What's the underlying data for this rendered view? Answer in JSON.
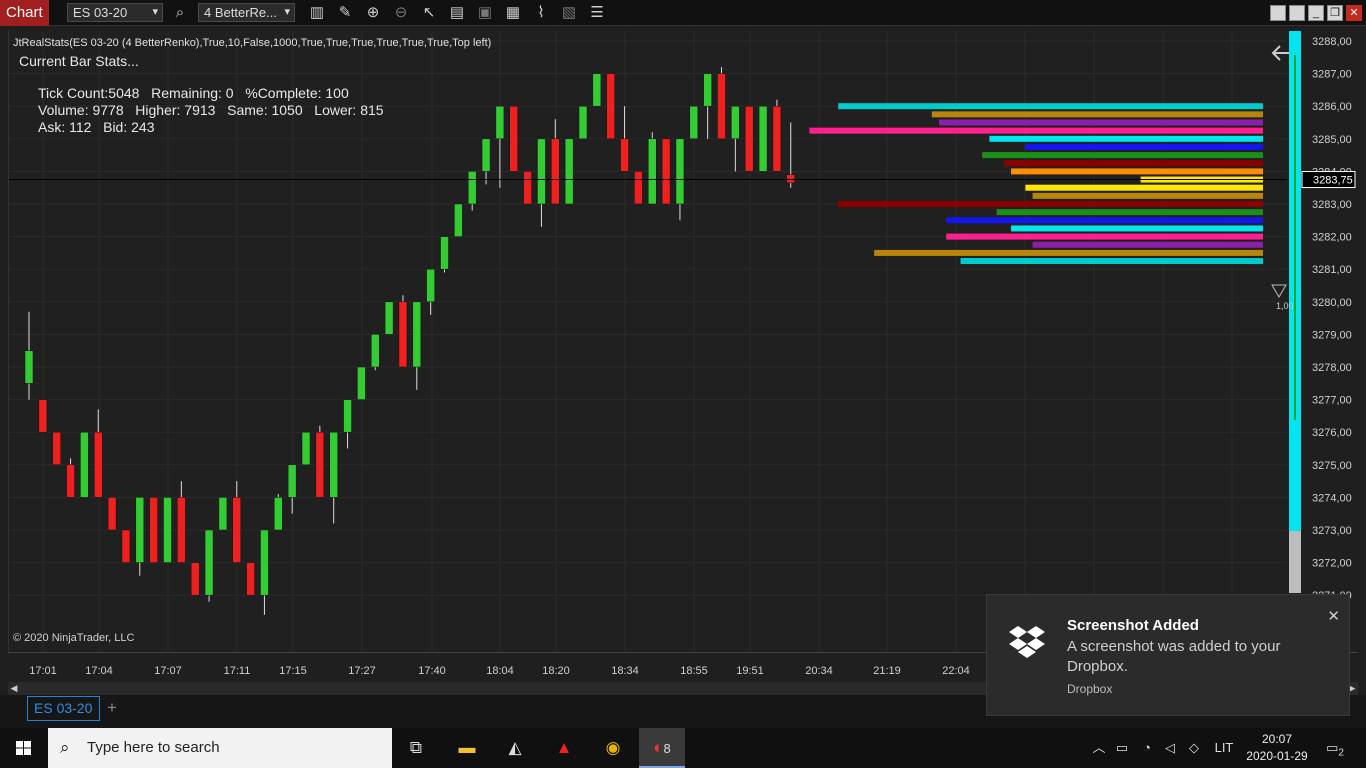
{
  "toolbar": {
    "chart_tab": "Chart",
    "instrument": "ES 03-20",
    "bar_type": "4 BetterRe...",
    "icons": [
      "search-icon",
      "bar-style-icon",
      "drawing-tool-icon",
      "zoom-in-icon",
      "zoom-out-icon",
      "pointer-icon",
      "data-box-icon",
      "chart-properties-icon",
      "strategy-icon",
      "indicator-icon",
      "templates-icon",
      "menu-icon"
    ],
    "window_controls": [
      "tile-icon",
      "minimize-icon",
      "restore-icon",
      "close-icon"
    ]
  },
  "chart": {
    "indicator_label": "JtRealStats(ES 03-20 (4 BetterRenko),True,10,False,1000,True,True,True,True,True,True,Top left)",
    "stats_title": "Current Bar Stats...",
    "stats_lines": [
      "Tick Count:5048   Remaining: 0   %Complete: 100",
      "Volume: 9778   Higher: 7913   Same: 1050   Lower: 815",
      "Ask: 112   Bid: 243"
    ],
    "copyright": "© 2020 NinjaTrader, LLC",
    "current_price_label": "3283,75",
    "price_ticks": [
      "3288,00",
      "3287,00",
      "3286,00",
      "3285,00",
      "3284,00",
      "3283,00",
      "3282,00",
      "3281,00",
      "3280,00",
      "3279,00",
      "3278,00",
      "3277,00",
      "3276,00",
      "3275,00",
      "3274,00",
      "3273,00",
      "3272,00",
      "3271,00"
    ],
    "time_ticks": [
      "17:01",
      "17:04",
      "17:07",
      "17:11",
      "17:15",
      "17:27",
      "17:40",
      "18:04",
      "18:20",
      "18:34",
      "18:55",
      "19:51",
      "20:34",
      "21:19",
      "22:04"
    ],
    "side_marker": "1,00",
    "colors": {
      "up": "#33cc33",
      "down": "#ee2020",
      "wick": "#dddddd",
      "volume_bar": "#00e5ee"
    }
  },
  "chart_data": {
    "type": "candlestick",
    "y_unit": "price",
    "ylim": [
      3270.75,
      3288.25
    ],
    "candles": [
      {
        "o": 3277.5,
        "c": 3278.5,
        "l": 3277.0,
        "h": 3279.7
      },
      {
        "o": 3277.0,
        "c": 3276.0,
        "l": 3276.0,
        "h": 3277.0
      },
      {
        "o": 3276.0,
        "c": 3275.0,
        "l": 3275.0,
        "h": 3276.0
      },
      {
        "o": 3275.0,
        "c": 3274.0,
        "l": 3274.0,
        "h": 3275.2
      },
      {
        "o": 3274.0,
        "c": 3276.0,
        "l": 3274.0,
        "h": 3276.0
      },
      {
        "o": 3276.0,
        "c": 3274.0,
        "l": 3274.0,
        "h": 3276.7
      },
      {
        "o": 3274.0,
        "c": 3273.0,
        "l": 3273.0,
        "h": 3274.0
      },
      {
        "o": 3273.0,
        "c": 3272.0,
        "l": 3272.0,
        "h": 3273.0
      },
      {
        "o": 3272.0,
        "c": 3274.0,
        "l": 3271.6,
        "h": 3274.0
      },
      {
        "o": 3274.0,
        "c": 3272.0,
        "l": 3272.0,
        "h": 3274.0
      },
      {
        "o": 3272.0,
        "c": 3274.0,
        "l": 3272.0,
        "h": 3274.0
      },
      {
        "o": 3274.0,
        "c": 3272.0,
        "l": 3272.0,
        "h": 3274.5
      },
      {
        "o": 3272.0,
        "c": 3271.0,
        "l": 3271.0,
        "h": 3272.0
      },
      {
        "o": 3271.0,
        "c": 3273.0,
        "l": 3270.8,
        "h": 3273.0
      },
      {
        "o": 3273.0,
        "c": 3274.0,
        "l": 3273.0,
        "h": 3274.0
      },
      {
        "o": 3274.0,
        "c": 3272.0,
        "l": 3272.0,
        "h": 3274.5
      },
      {
        "o": 3272.0,
        "c": 3271.0,
        "l": 3271.0,
        "h": 3272.0
      },
      {
        "o": 3271.0,
        "c": 3273.0,
        "l": 3270.4,
        "h": 3273.0
      },
      {
        "o": 3273.0,
        "c": 3274.0,
        "l": 3273.0,
        "h": 3274.1
      },
      {
        "o": 3274.0,
        "c": 3275.0,
        "l": 3273.5,
        "h": 3275.0
      },
      {
        "o": 3275.0,
        "c": 3276.0,
        "l": 3275.0,
        "h": 3276.0
      },
      {
        "o": 3276.0,
        "c": 3274.0,
        "l": 3274.0,
        "h": 3276.2
      },
      {
        "o": 3274.0,
        "c": 3276.0,
        "l": 3273.2,
        "h": 3276.0
      },
      {
        "o": 3276.0,
        "c": 3277.0,
        "l": 3275.5,
        "h": 3277.0
      },
      {
        "o": 3277.0,
        "c": 3278.0,
        "l": 3277.0,
        "h": 3278.0
      },
      {
        "o": 3278.0,
        "c": 3279.0,
        "l": 3277.9,
        "h": 3279.0
      },
      {
        "o": 3279.0,
        "c": 3280.0,
        "l": 3279.0,
        "h": 3280.0
      },
      {
        "o": 3280.0,
        "c": 3278.0,
        "l": 3278.0,
        "h": 3280.2
      },
      {
        "o": 3278.0,
        "c": 3280.0,
        "l": 3277.3,
        "h": 3280.0
      },
      {
        "o": 3280.0,
        "c": 3281.0,
        "l": 3279.6,
        "h": 3281.0
      },
      {
        "o": 3281.0,
        "c": 3282.0,
        "l": 3280.9,
        "h": 3282.0
      },
      {
        "o": 3282.0,
        "c": 3283.0,
        "l": 3282.0,
        "h": 3283.0
      },
      {
        "o": 3283.0,
        "c": 3284.0,
        "l": 3282.8,
        "h": 3284.0
      },
      {
        "o": 3284.0,
        "c": 3285.0,
        "l": 3283.6,
        "h": 3285.0
      },
      {
        "o": 3285.0,
        "c": 3286.0,
        "l": 3283.5,
        "h": 3286.0
      },
      {
        "o": 3286.0,
        "c": 3284.0,
        "l": 3284.0,
        "h": 3286.0
      },
      {
        "o": 3284.0,
        "c": 3283.0,
        "l": 3283.0,
        "h": 3284.0
      },
      {
        "o": 3283.0,
        "c": 3285.0,
        "l": 3282.3,
        "h": 3285.0
      },
      {
        "o": 3285.0,
        "c": 3283.0,
        "l": 3283.0,
        "h": 3285.6
      },
      {
        "o": 3283.0,
        "c": 3285.0,
        "l": 3283.0,
        "h": 3285.0
      },
      {
        "o": 3285.0,
        "c": 3286.0,
        "l": 3285.0,
        "h": 3286.0
      },
      {
        "o": 3286.0,
        "c": 3287.0,
        "l": 3286.0,
        "h": 3287.0
      },
      {
        "o": 3287.0,
        "c": 3285.0,
        "l": 3285.0,
        "h": 3287.0
      },
      {
        "o": 3285.0,
        "c": 3284.0,
        "l": 3284.0,
        "h": 3286.0
      },
      {
        "o": 3284.0,
        "c": 3283.0,
        "l": 3283.0,
        "h": 3284.0
      },
      {
        "o": 3283.0,
        "c": 3285.0,
        "l": 3283.0,
        "h": 3285.2
      },
      {
        "o": 3285.0,
        "c": 3283.0,
        "l": 3283.0,
        "h": 3285.0
      },
      {
        "o": 3283.0,
        "c": 3285.0,
        "l": 3282.5,
        "h": 3285.0
      },
      {
        "o": 3285.0,
        "c": 3286.0,
        "l": 3285.0,
        "h": 3286.0
      },
      {
        "o": 3286.0,
        "c": 3287.0,
        "l": 3285.0,
        "h": 3287.0
      },
      {
        "o": 3287.0,
        "c": 3285.0,
        "l": 3285.0,
        "h": 3287.2
      },
      {
        "o": 3285.0,
        "c": 3286.0,
        "l": 3284.0,
        "h": 3286.0
      },
      {
        "o": 3286.0,
        "c": 3284.0,
        "l": 3284.0,
        "h": 3286.0
      },
      {
        "o": 3284.0,
        "c": 3286.0,
        "l": 3284.0,
        "h": 3286.0
      },
      {
        "o": 3286.0,
        "c": 3284.0,
        "l": 3284.0,
        "h": 3286.2
      },
      {
        "o": 3283.9,
        "c": 3283.65,
        "l": 3283.5,
        "h": 3285.5
      }
    ],
    "volume_profile": [
      {
        "price": 3286.0,
        "strength": 0.59,
        "color": "#00cccc"
      },
      {
        "price": 3285.75,
        "strength": 0.46,
        "color": "#b8860b"
      },
      {
        "price": 3285.5,
        "strength": 0.45,
        "color": "#8b1fa8"
      },
      {
        "price": 3285.25,
        "strength": 0.63,
        "color": "#ff1f8f"
      },
      {
        "price": 3285.0,
        "strength": 0.38,
        "color": "#00e5ee"
      },
      {
        "price": 3284.75,
        "strength": 0.33,
        "color": "#1515ee"
      },
      {
        "price": 3284.5,
        "strength": 0.39,
        "color": "#1a8f1a"
      },
      {
        "price": 3284.25,
        "strength": 0.36,
        "color": "#8b0000"
      },
      {
        "price": 3284.0,
        "strength": 0.35,
        "color": "#ff8c00"
      },
      {
        "price": 3283.75,
        "strength": 0.17,
        "color": "#ffe600"
      },
      {
        "price": 3283.5,
        "strength": 0.33,
        "color": "#ffe600"
      },
      {
        "price": 3283.25,
        "strength": 0.32,
        "color": "#b8860b"
      },
      {
        "price": 3283.0,
        "strength": 0.59,
        "color": "#8b0000"
      },
      {
        "price": 3282.75,
        "strength": 0.37,
        "color": "#1a8f1a"
      },
      {
        "price": 3282.5,
        "strength": 0.44,
        "color": "#1515ee"
      },
      {
        "price": 3282.25,
        "strength": 0.35,
        "color": "#00e5ee"
      },
      {
        "price": 3282.0,
        "strength": 0.44,
        "color": "#ff1f8f"
      },
      {
        "price": 3281.75,
        "strength": 0.32,
        "color": "#8b1fa8"
      },
      {
        "price": 3281.5,
        "strength": 0.54,
        "color": "#b8860b"
      },
      {
        "price": 3281.25,
        "strength": 0.42,
        "color": "#00cccc"
      }
    ]
  },
  "tabs": {
    "active": "ES 03-20",
    "add": "+"
  },
  "taskbar": {
    "search_placeholder": "Type here to search",
    "apps": [
      "task-view-icon",
      "file-explorer-icon",
      "app-fox-icon",
      "acrobat-icon",
      "chrome-icon",
      "ninjatrader-icon"
    ],
    "ninja_badge": "8",
    "language": "LIT",
    "time": "20:07",
    "date": "2020-01-29",
    "notifications_count": "2"
  },
  "toast": {
    "title": "Screenshot Added",
    "body": "A screenshot was added to your Dropbox.",
    "source": "Dropbox"
  }
}
